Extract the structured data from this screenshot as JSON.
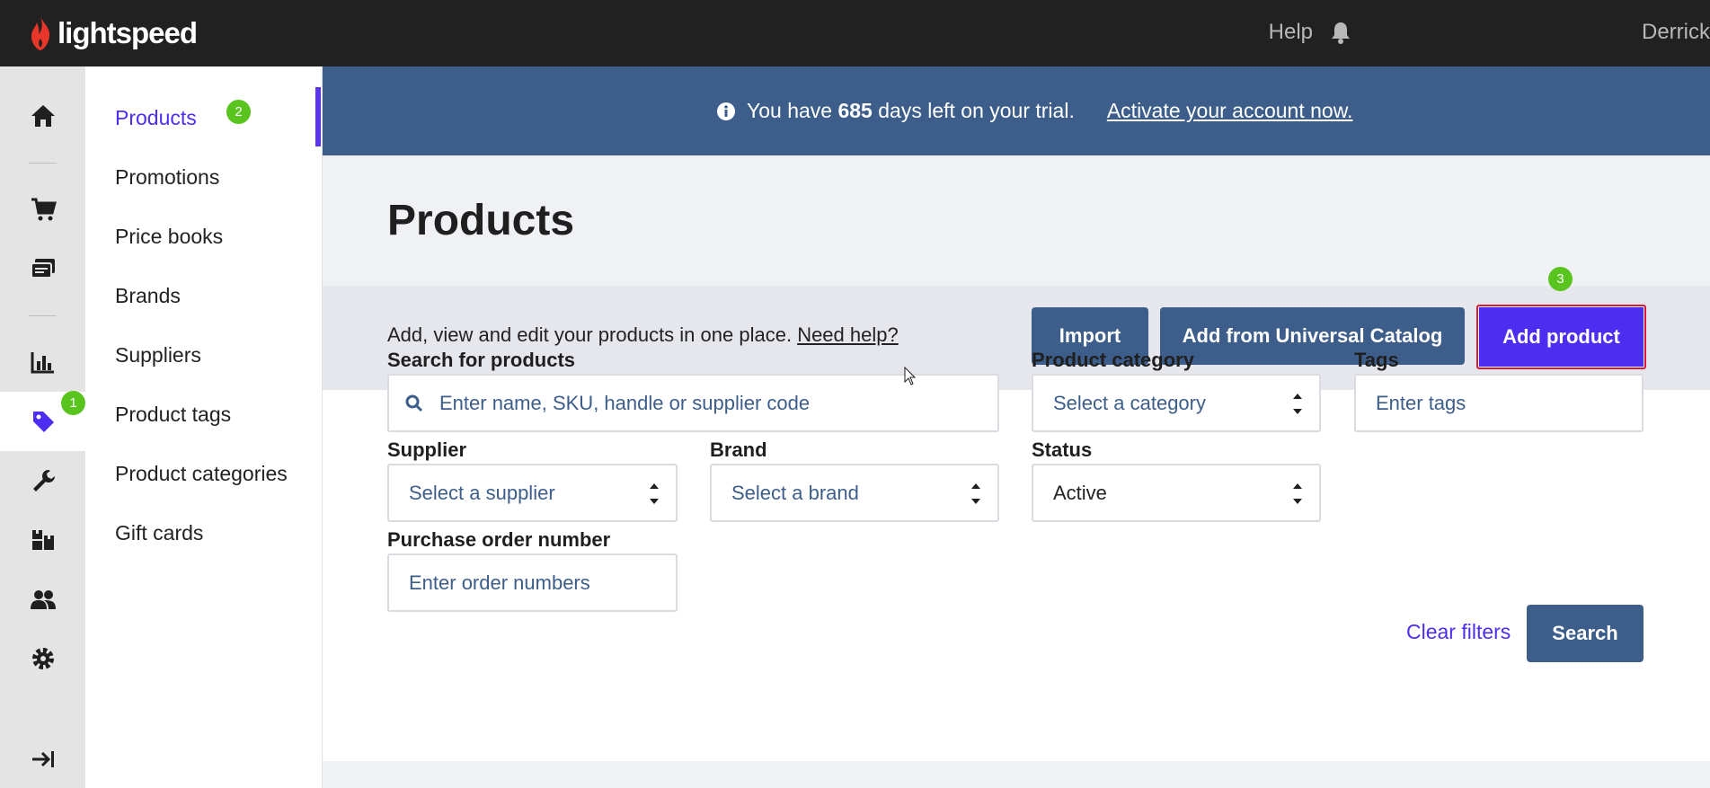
{
  "topbar": {
    "logo_text": "lightspeed",
    "help_label": "Help",
    "user_name": "Derrick",
    "brand_color": "#e8362b"
  },
  "rail": {
    "badges": {
      "products": "1"
    }
  },
  "subnav": {
    "items": [
      {
        "label": "Products",
        "active": true
      },
      {
        "label": "Promotions"
      },
      {
        "label": "Price books"
      },
      {
        "label": "Brands"
      },
      {
        "label": "Suppliers"
      },
      {
        "label": "Product tags"
      },
      {
        "label": "Product categories"
      },
      {
        "label": "Gift cards"
      }
    ],
    "badge": "2"
  },
  "trial": {
    "prefix": "You have",
    "days": "685",
    "suffix": "days left on your trial.",
    "link": "Activate your account now."
  },
  "page": {
    "title": "Products",
    "description": "Add, view and edit your products in one place.",
    "help_link": "Need help?"
  },
  "actions": {
    "import": "Import",
    "catalog": "Add from Universal Catalog",
    "add_product": "Add product",
    "badge": "3"
  },
  "filters": {
    "search_label": "Search for products",
    "search_placeholder": "Enter name, SKU, handle or supplier code",
    "category_label": "Product category",
    "category_value": "Select a category",
    "tags_label": "Tags",
    "tags_placeholder": "Enter tags",
    "supplier_label": "Supplier",
    "supplier_value": "Select a supplier",
    "brand_label": "Brand",
    "brand_value": "Select a brand",
    "status_label": "Status",
    "status_value": "Active",
    "po_label": "Purchase order number",
    "po_placeholder": "Enter order numbers",
    "clear": "Clear filters",
    "search_button": "Search"
  },
  "colors": {
    "accent": "#4d2ef0",
    "primary_button": "#3d5e8a",
    "badge": "#5ac41e"
  }
}
